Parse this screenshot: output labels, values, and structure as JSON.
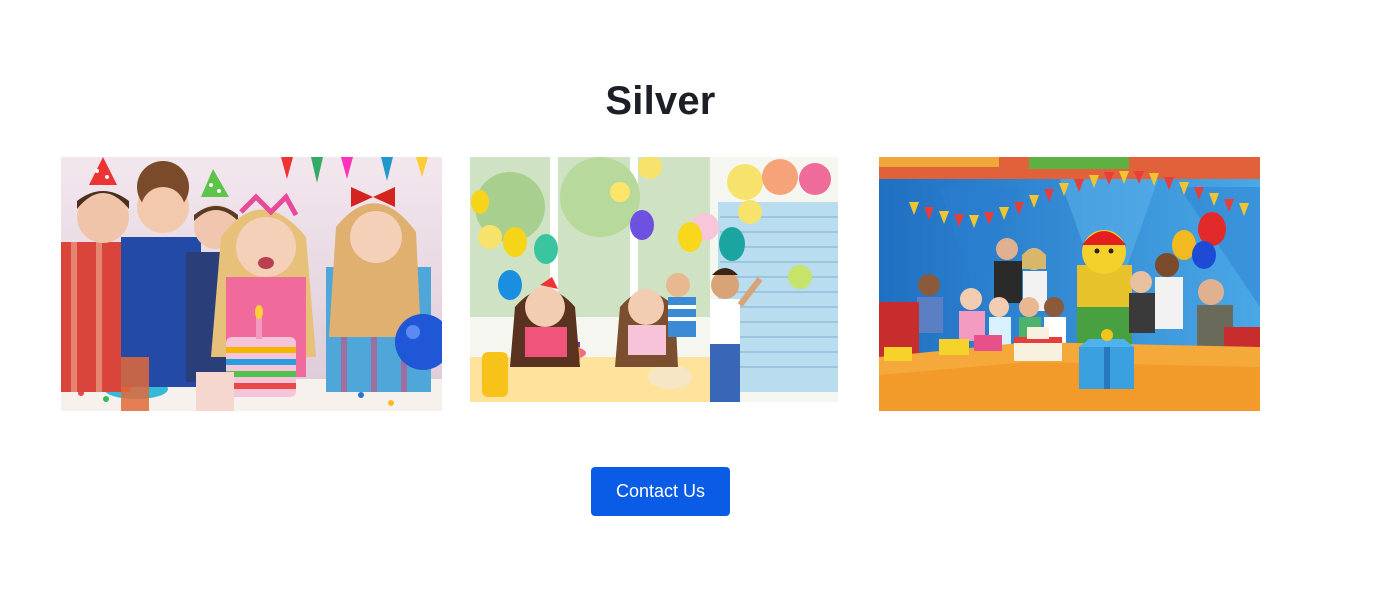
{
  "section": {
    "title": "Silver"
  },
  "gallery": [
    {
      "subject": "kids-around-birthday-cake"
    },
    {
      "subject": "girls-at-party-table-with-balloons"
    },
    {
      "subject": "lego-party-room-with-mascot"
    }
  ],
  "cta": {
    "label": "Contact Us"
  },
  "colors": {
    "title_text": "#1c2026",
    "button_bg": "#0a5ce6",
    "button_text": "#ffffff",
    "page_bg": "#ffffff"
  }
}
